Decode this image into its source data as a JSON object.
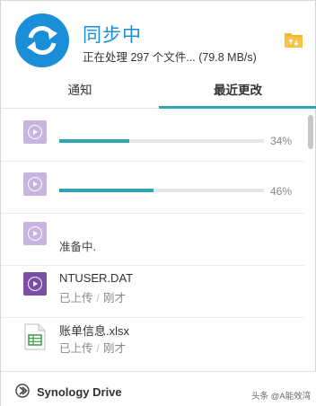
{
  "header": {
    "status_title": "同步中",
    "status_detail": "正在处理 297 个文件... (79.8 MB/s)"
  },
  "tabs": [
    {
      "label": "通知",
      "active": false
    },
    {
      "label": "最近更改",
      "active": true
    }
  ],
  "items": [
    {
      "type": "video",
      "state": "uploading",
      "progress_percent": 34,
      "progress_label": "34%"
    },
    {
      "type": "video",
      "state": "uploading",
      "progress_percent": 46,
      "progress_label": "46%"
    },
    {
      "type": "video",
      "state": "pending",
      "status": "准备中."
    },
    {
      "type": "video",
      "state": "done",
      "name": "NTUSER.DAT",
      "status": "已上传",
      "time": "刚才"
    },
    {
      "type": "spreadsheet",
      "state": "done",
      "name": "账单信息.xlsx",
      "status": "已上传",
      "time": "刚才"
    }
  ],
  "footer": {
    "brand": "Synology Drive",
    "watermark": "头条 @A能效湾"
  },
  "colors": {
    "accent_blue": "#1a8fd8",
    "progress_teal": "#2fa5b3",
    "video_pending": "#c9b3df",
    "video_done": "#7b4ea6",
    "folder_yellow": "#f2b632"
  },
  "icons": {
    "sync": "sync-arrows-icon",
    "folder": "folder-sync-icon",
    "video": "video-file-icon",
    "spreadsheet": "xlsx-file-icon",
    "brand": "synology-drive-logo"
  }
}
